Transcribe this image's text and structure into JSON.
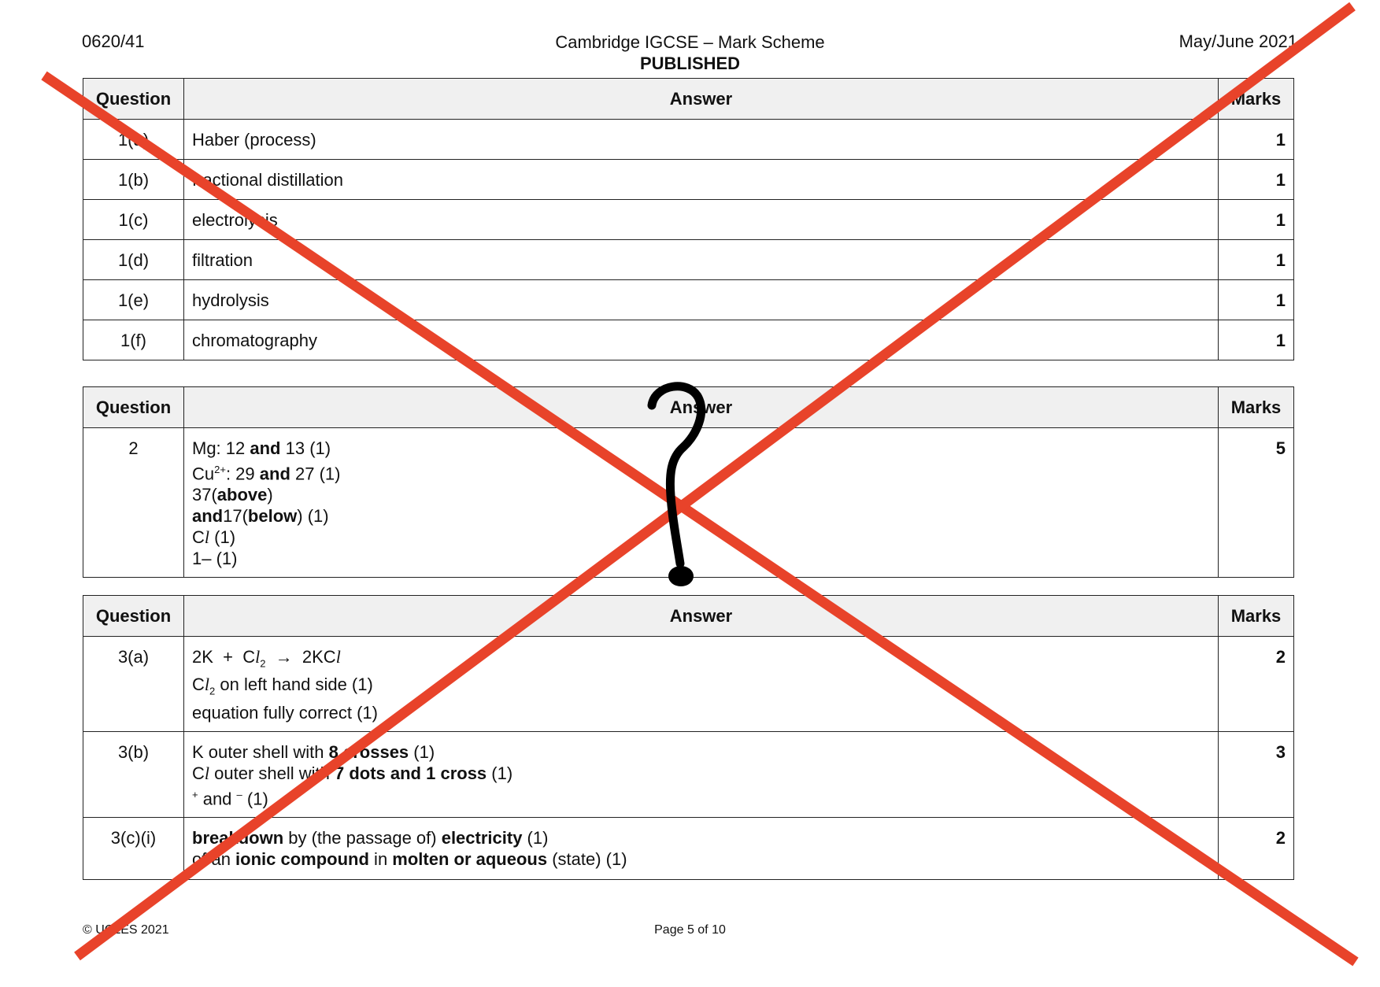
{
  "header": {
    "code": "0620/41",
    "title": "Cambridge IGCSE – Mark Scheme",
    "subtitle": "PUBLISHED",
    "session": "May/June 2021"
  },
  "columns": {
    "question": "Question",
    "answer": "Answer",
    "marks": "Marks"
  },
  "q1_rows": [
    {
      "q": "1(a)",
      "answer": "Haber (process)",
      "marks": "1"
    },
    {
      "q": "1(b)",
      "answer": "fractional distillation",
      "marks": "1"
    },
    {
      "q": "1(c)",
      "answer": "electrolysis",
      "marks": "1"
    },
    {
      "q": "1(d)",
      "answer": "filtration",
      "marks": "1"
    },
    {
      "q": "1(e)",
      "answer": "hydrolysis",
      "marks": "1"
    },
    {
      "q": "1(f)",
      "answer": "chromatography",
      "marks": "1"
    }
  ],
  "q2": {
    "q": "2",
    "marks": "5",
    "lines": {
      "l1a": "Mg: 12 ",
      "l1b": "and",
      "l1c": " 13 (1)",
      "l2a": "Cu",
      "l2sup": "2+",
      "l2b": ": 29 ",
      "l2c": "and",
      "l2d": " 27 (1)",
      "l3a": "37(",
      "l3b": "above",
      "l3c": ")",
      "l4a": "and",
      "l4b": "17(",
      "l4c": "below",
      "l4d": ") (1)",
      "l5a": "C",
      "l5b": "l",
      "l5c": " (1)",
      "l6": "1– (1)"
    }
  },
  "q3a": {
    "q": "3(a)",
    "marks": "2",
    "eq_k": "2K  +  C",
    "eq_l": "l",
    "eq_sub": "2",
    "eq_arrow": "  →  2KC",
    "eq_l2": "l",
    "l2a": "C",
    "l2l": "l",
    "l2sub": "2",
    "l2b": " on left hand side (1)",
    "l3": "equation fully correct (1)"
  },
  "q3b": {
    "q": "3(b)",
    "marks": "3",
    "l1a": "K outer shell with ",
    "l1b": "8 crosses",
    "l1c": " (1)",
    "l2a": "C",
    "l2l": "l",
    "l2b": " outer shell with ",
    "l2c": "7 dots and 1 cross",
    "l2d": " (1)",
    "l3plus": "+",
    "l3a": " and ",
    "l3minus": "–",
    "l3b": " (1)"
  },
  "q3ci": {
    "q": "3(c)(i)",
    "marks": "2",
    "l1a": "breakdown",
    "l1b": " by (the passage of) ",
    "l1c": "electricity",
    "l1d": " (1)",
    "l2a": "of an ",
    "l2b": "ionic compound",
    "l2c": " in ",
    "l2d": "molten or aqueous",
    "l2e": " (state) (1)"
  },
  "footer": {
    "copyright": "© UCLES 2021",
    "page": "Page 5 of 10"
  },
  "annotation": {
    "cross_color": "#e8432a",
    "question_mark": "?"
  }
}
